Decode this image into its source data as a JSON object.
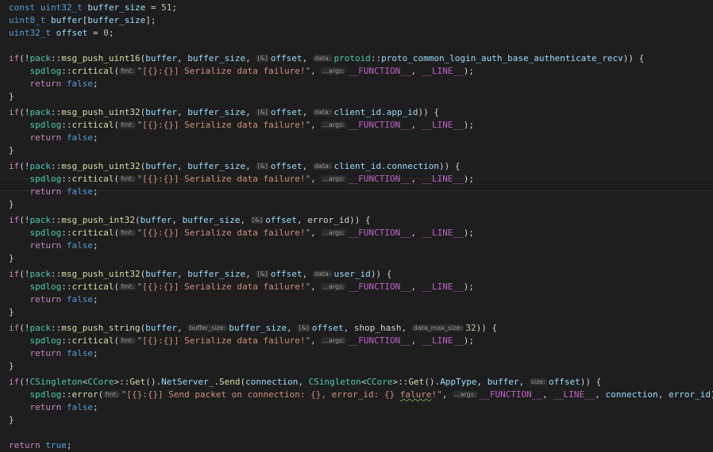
{
  "decl": {
    "const_kw": "const",
    "uint32": "uint32_t",
    "uint8": "uint8_t",
    "buffer_size": "buffer_size",
    "buffer": "buffer",
    "offset": "offset",
    "eq51": " = ",
    "v51": "51",
    "v0": "0",
    "arr_open": "[",
    "arr_close": "];",
    "semi": ";"
  },
  "common": {
    "if_kw": "if",
    "open_neg": "(!",
    "pack_ns": "pack",
    "sep": "::",
    "spdlog_ns": "spdlog",
    "critical_fn": "critical",
    "error_fn": "error",
    "fmt_hint": "fmt:",
    "args_hint": "...args:",
    "data_hint": "data:",
    "amp_hint": "[&]",
    "fmt_string": "\"[{}:{}] Serialize data failure!\"",
    "function_macro": "__FUNCTION__",
    "line_macro": "__LINE__",
    "return_kw": "return",
    "false_kw": "false",
    "true_kw": "true",
    "open_brace": "{",
    "close_brace": "}"
  },
  "blocks": [
    {
      "fn": "msg_push_uint16",
      "data_text": "proto_common_login_auth_base_authenticate_recv",
      "ns": "protoid"
    },
    {
      "fn": "msg_push_uint32",
      "data_text": "client_id.app_id"
    },
    {
      "fn": "msg_push_uint32",
      "data_text": "client_id.connection"
    },
    {
      "fn": "msg_push_int32",
      "data_text": "error_id"
    },
    {
      "fn": "msg_push_uint32",
      "data_text": "user_id"
    },
    {
      "fn": "msg_push_string",
      "shop_hash": "shop_hash",
      "buffer_size_hint": "buffer_size:",
      "data_max_size_hint": "data_max_size:",
      "max_value": "32"
    }
  ],
  "send_block": {
    "singleton": "CSingleton",
    "ccore": "CCore",
    "get": "Get",
    "netserver": "NetServer_",
    "send": "Send",
    "connection": "connection",
    "apptype": "AppType",
    "size_hint": "size:",
    "error_string_pre": "\"[{}:{}] Send packet on connection: {}, error_id: {} ",
    "error_string_squiggle": "falure",
    "error_string_post": "!\"",
    "error_id": "error_id"
  }
}
